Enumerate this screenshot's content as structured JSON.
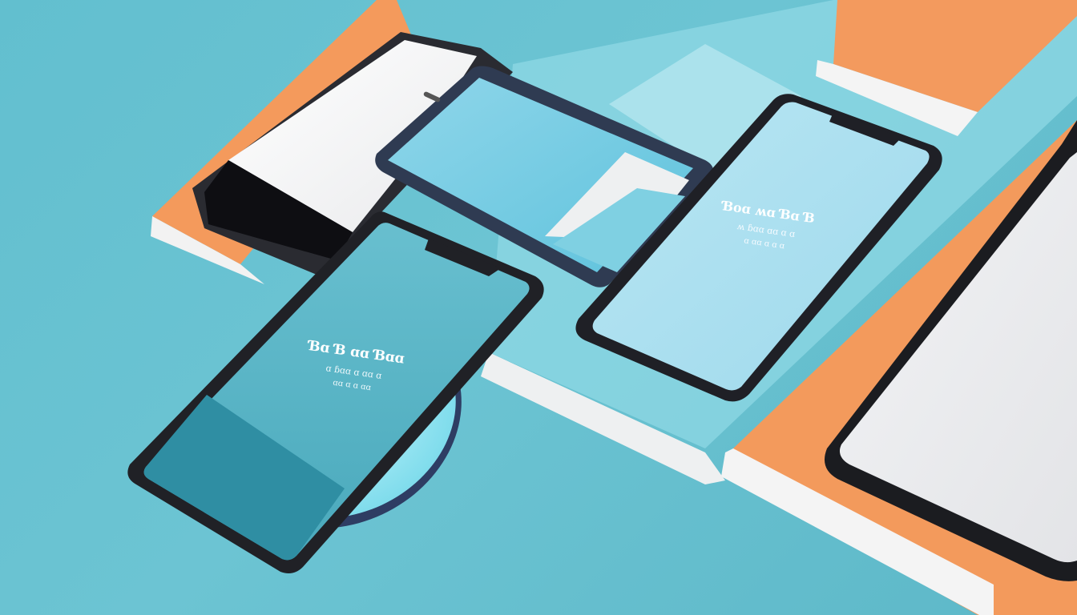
{
  "scene": {
    "description_colors": {
      "background": "#66c2d1",
      "accent_orange": "#f49a5c",
      "panel_white": "#f3f3f3",
      "screen_light_blue": "#a9dff0",
      "screen_teal": "#3fa3b5",
      "phone_frame": "#1e1f24"
    }
  },
  "phones": {
    "center_right": {
      "line1": "Ɓoɑ ʍɑ Ɓɑ Ɓ",
      "line2": "ʍ ɓɑɑ ɑɑ ɑ ɑ",
      "line3": "ɑ ɑɑ ɑ ɑ ɑ"
    },
    "front_left": {
      "line1": "Ɓɑ Ɓ ɑɑ Ɓɑɑ",
      "line2": "ɑ ɓɑɑ ɑ ɑɑ ɑ",
      "line3": "ɑɑ ɑ ɑ ɑɑ"
    }
  }
}
